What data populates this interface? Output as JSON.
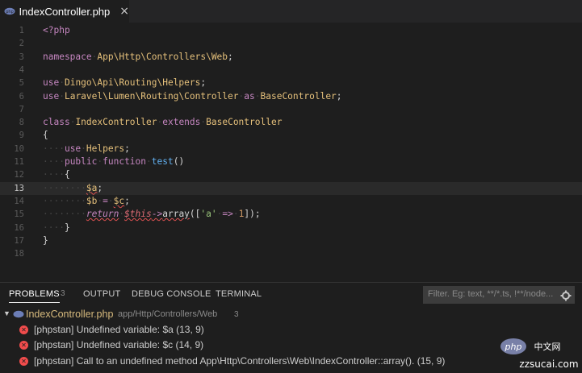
{
  "tab": {
    "filename": "IndexController.php",
    "close_glyph": "×",
    "icon": "php-file-icon"
  },
  "editor": {
    "lines": [
      {
        "n": "1",
        "segments": [
          {
            "c": "tag",
            "t": "<?php"
          }
        ]
      },
      {
        "n": "2",
        "segments": []
      },
      {
        "n": "3",
        "segments": [
          {
            "c": "kw",
            "t": "namespace"
          },
          {
            "c": "ws",
            "t": "·"
          },
          {
            "c": "cls",
            "t": "App\\Http\\Controllers\\Web"
          },
          {
            "c": "pun",
            "t": ";"
          }
        ]
      },
      {
        "n": "4",
        "segments": []
      },
      {
        "n": "5",
        "segments": [
          {
            "c": "kw",
            "t": "use"
          },
          {
            "c": "ws",
            "t": "·"
          },
          {
            "c": "cls",
            "t": "Dingo\\Api\\Routing\\Helpers"
          },
          {
            "c": "pun",
            "t": ";"
          }
        ]
      },
      {
        "n": "6",
        "segments": [
          {
            "c": "kw",
            "t": "use"
          },
          {
            "c": "ws",
            "t": "·"
          },
          {
            "c": "cls",
            "t": "Laravel\\Lumen\\Routing\\Controller"
          },
          {
            "c": "ws",
            "t": "·"
          },
          {
            "c": "kw",
            "t": "as"
          },
          {
            "c": "ws",
            "t": "·"
          },
          {
            "c": "cls",
            "t": "BaseController"
          },
          {
            "c": "pun",
            "t": ";"
          }
        ]
      },
      {
        "n": "7",
        "segments": []
      },
      {
        "n": "8",
        "segments": [
          {
            "c": "kw",
            "t": "class"
          },
          {
            "c": "ws",
            "t": "·"
          },
          {
            "c": "cls",
            "t": "IndexController"
          },
          {
            "c": "ws",
            "t": "·"
          },
          {
            "c": "kw",
            "t": "extends"
          },
          {
            "c": "ws",
            "t": "·"
          },
          {
            "c": "cls",
            "t": "BaseController"
          }
        ]
      },
      {
        "n": "9",
        "segments": [
          {
            "c": "pun",
            "t": "{"
          }
        ]
      },
      {
        "n": "10",
        "segments": [
          {
            "c": "ws",
            "t": "····"
          },
          {
            "c": "kw",
            "t": "use"
          },
          {
            "c": "ws",
            "t": "·"
          },
          {
            "c": "cls",
            "t": "Helpers"
          },
          {
            "c": "pun",
            "t": ";"
          }
        ]
      },
      {
        "n": "11",
        "segments": [
          {
            "c": "ws",
            "t": "····"
          },
          {
            "c": "kw",
            "t": "public"
          },
          {
            "c": "ws",
            "t": "·"
          },
          {
            "c": "kw",
            "t": "function"
          },
          {
            "c": "ws",
            "t": "·"
          },
          {
            "c": "fn",
            "t": "test"
          },
          {
            "c": "pun",
            "t": "()"
          }
        ]
      },
      {
        "n": "12",
        "segments": [
          {
            "c": "ws",
            "t": "····"
          },
          {
            "c": "pun",
            "t": "{"
          }
        ]
      },
      {
        "n": "13",
        "segments": [
          {
            "c": "ws",
            "t": "········"
          },
          {
            "c": "var sq",
            "t": "$a"
          },
          {
            "c": "pun",
            "t": ";"
          }
        ]
      },
      {
        "n": "14",
        "segments": [
          {
            "c": "ws",
            "t": "········"
          },
          {
            "c": "var",
            "t": "$b"
          },
          {
            "c": "ws",
            "t": "·"
          },
          {
            "c": "kw",
            "t": "="
          },
          {
            "c": "ws",
            "t": "·"
          },
          {
            "c": "var sq",
            "t": "$c"
          },
          {
            "c": "pun",
            "t": ";"
          }
        ]
      },
      {
        "n": "15",
        "segments": [
          {
            "c": "ws",
            "t": "········"
          },
          {
            "c": "ret sq",
            "t": "return"
          },
          {
            "c": "ws",
            "t": "·"
          },
          {
            "c": "this sq",
            "t": "$this"
          },
          {
            "c": "kw sq",
            "t": "->"
          },
          {
            "c": "pun sq",
            "t": "array"
          },
          {
            "c": "pun",
            "t": "(["
          },
          {
            "c": "str",
            "t": "'a'"
          },
          {
            "c": "ws",
            "t": "·"
          },
          {
            "c": "kw",
            "t": "=>"
          },
          {
            "c": "ws",
            "t": "·"
          },
          {
            "c": "num",
            "t": "1"
          },
          {
            "c": "pun",
            "t": "]);"
          }
        ]
      },
      {
        "n": "16",
        "segments": [
          {
            "c": "ws",
            "t": "····"
          },
          {
            "c": "pun",
            "t": "}"
          }
        ]
      },
      {
        "n": "17",
        "segments": [
          {
            "c": "pun",
            "t": "}"
          }
        ]
      },
      {
        "n": "18",
        "segments": []
      }
    ],
    "active_line": "13"
  },
  "panel": {
    "tabs": [
      {
        "label": "PROBLEMS",
        "badge": "3",
        "active": true
      },
      {
        "label": "OUTPUT"
      },
      {
        "label": "DEBUG CONSOLE"
      },
      {
        "label": "TERMINAL"
      }
    ],
    "filter_placeholder": "Filter. Eg: text, **/*.ts, !**/node...",
    "filter_icon": "clear-filter-icon",
    "file": {
      "name": "IndexController.php",
      "path": "app/Http/Controllers/Web",
      "count": "3"
    },
    "problems": [
      {
        "text": "[phpstan] Undefined variable: $a (13, 9)"
      },
      {
        "text": "[phpstan] Undefined variable: $c (14, 9)"
      },
      {
        "text": "[phpstan] Call to an undefined method App\\Http\\Controllers\\Web\\IndexController::array(). (15, 9)"
      }
    ]
  },
  "watermark": {
    "text_a": "php",
    "text_b": "中文网",
    "text_c": "zzsucai.com"
  },
  "colors": {
    "editor_bg": "#1e1e1e",
    "error": "#f14c4c",
    "file_name": "#d7ba7d"
  }
}
